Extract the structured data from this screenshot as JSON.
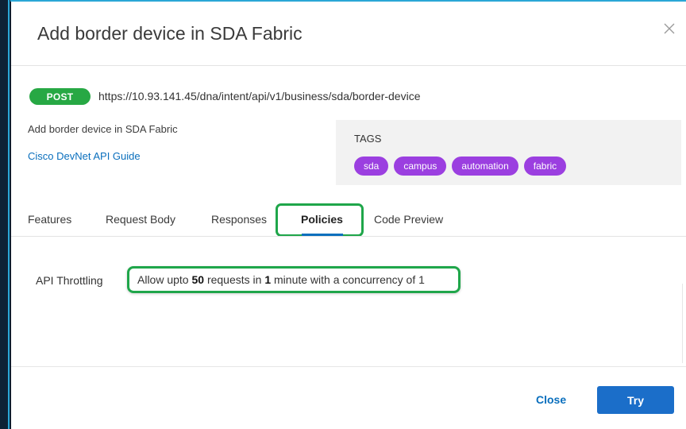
{
  "dialog": {
    "title": "Add border device in SDA Fabric"
  },
  "endpoint": {
    "method": "POST",
    "method_color": "#27a844",
    "url": "https://10.93.141.45/dna/intent/api/v1/business/sda/border-device",
    "description": "Add border device in SDA Fabric",
    "guide_link": "Cisco DevNet API Guide"
  },
  "tags": {
    "title": "TAGS",
    "color": "#9b3fe0",
    "items": [
      "sda",
      "campus",
      "automation",
      "fabric"
    ]
  },
  "tabs": {
    "items": [
      {
        "label": "Features",
        "active": false
      },
      {
        "label": "Request Body",
        "active": false
      },
      {
        "label": "Responses",
        "active": false
      },
      {
        "label": "Policies",
        "active": true
      },
      {
        "label": "Code Preview",
        "active": false
      }
    ],
    "accent": "#0a6fbd"
  },
  "policies": {
    "label": "API Throttling",
    "value_prefix": "Allow upto ",
    "requests": "50",
    "mid1": " requests in ",
    "minutes": "1",
    "mid2": " minute with a concurrency of 1",
    "highlight_color": "#1fa64a"
  },
  "footer": {
    "close_label": "Close",
    "try_label": "Try"
  },
  "icons": {
    "close": "close-icon"
  }
}
